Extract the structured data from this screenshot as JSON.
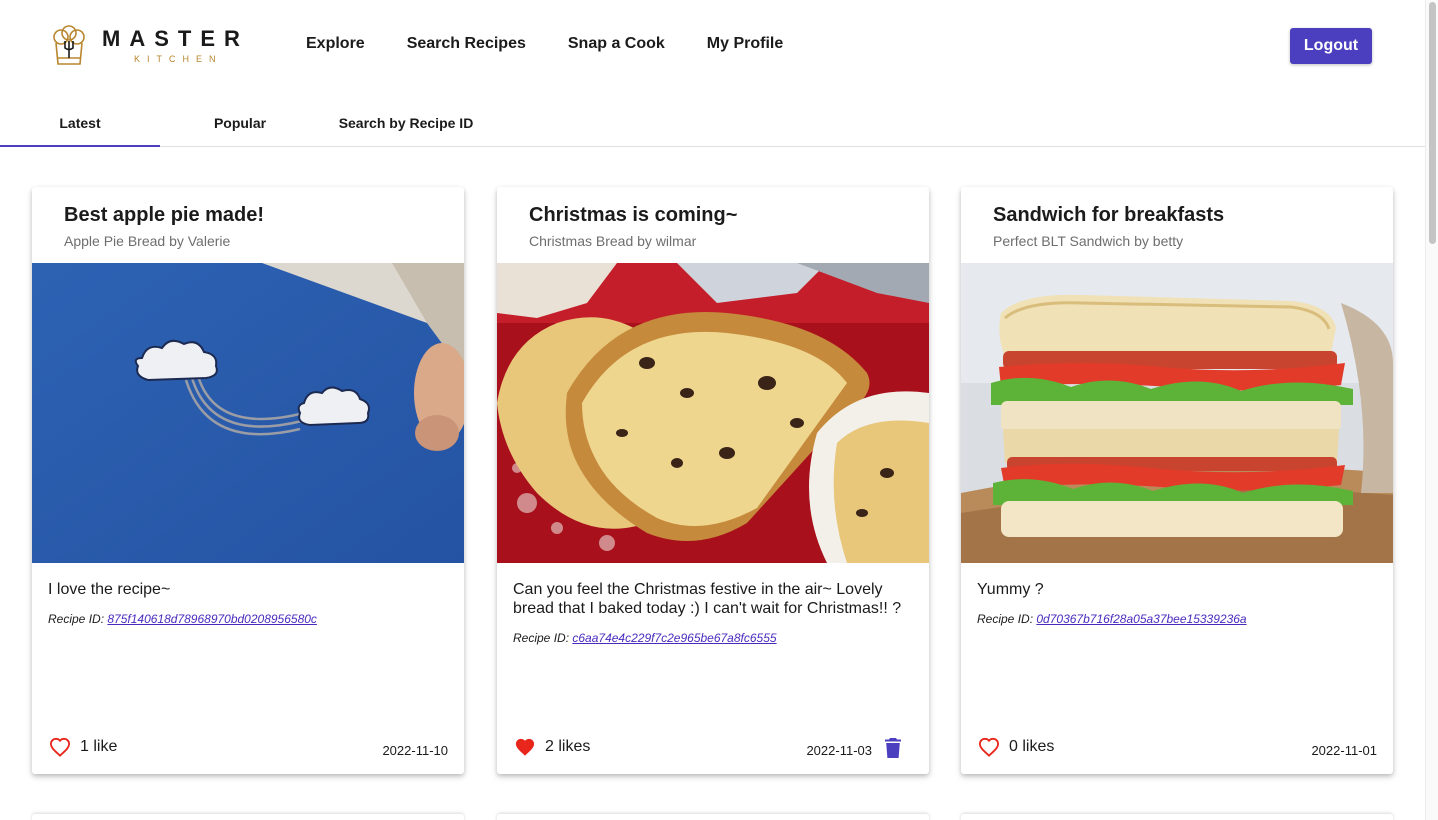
{
  "app": {
    "brand_main": "MASTER",
    "brand_sub": "KITCHEN"
  },
  "nav": {
    "items": [
      "Explore",
      "Search Recipes",
      "Snap a Cook",
      "My Profile"
    ],
    "logout_label": "Logout"
  },
  "tabs": [
    {
      "label": "Latest",
      "active": true
    },
    {
      "label": "Popular",
      "active": false
    },
    {
      "label": "Search by Recipe ID",
      "active": false
    }
  ],
  "colors": {
    "accent": "#4b3fbf",
    "heart": "#e8261b",
    "brand_gold": "#b8862e"
  },
  "cards": [
    {
      "title": "Best apple pie made!",
      "subtitle": "Apple Pie Bread by Valerie",
      "message": "I love the recipe~",
      "recipe_id_label": "Recipe ID:",
      "recipe_id": "875f140618d78968970bd0208956580c",
      "likes_text": "1 like",
      "liked": false,
      "date": "2022-11-10",
      "deletable": false,
      "image": "photo of a blue card with a cloud and rainbow drawing"
    },
    {
      "title": "Christmas is coming~",
      "subtitle": "Christmas Bread by wilmar",
      "message": "Can you feel the Christmas festive in the air~ Lovely bread that I baked today :) I can't wait for Christmas!! ?",
      "recipe_id_label": "Recipe ID:",
      "recipe_id": "c6aa74e4c229f7c2e965be67a8fc6555",
      "likes_text": "2 likes",
      "liked": true,
      "date": "2022-11-03",
      "deletable": true,
      "image": "photo of sliced christmas stollen bread on red cloth"
    },
    {
      "title": "Sandwich for breakfasts",
      "subtitle": "Perfect BLT Sandwich by betty",
      "message": "Yummy ?",
      "recipe_id_label": "Recipe ID:",
      "recipe_id": "0d70367b716f28a05a37bee15339236a",
      "likes_text": "0 likes",
      "liked": false,
      "date": "2022-11-01",
      "deletable": false,
      "image": "photo of stacked BLT sandwich on a wooden board"
    }
  ],
  "icons": {
    "logo": "chef-hat-icon",
    "like": "heart-icon",
    "delete": "trash-icon"
  }
}
